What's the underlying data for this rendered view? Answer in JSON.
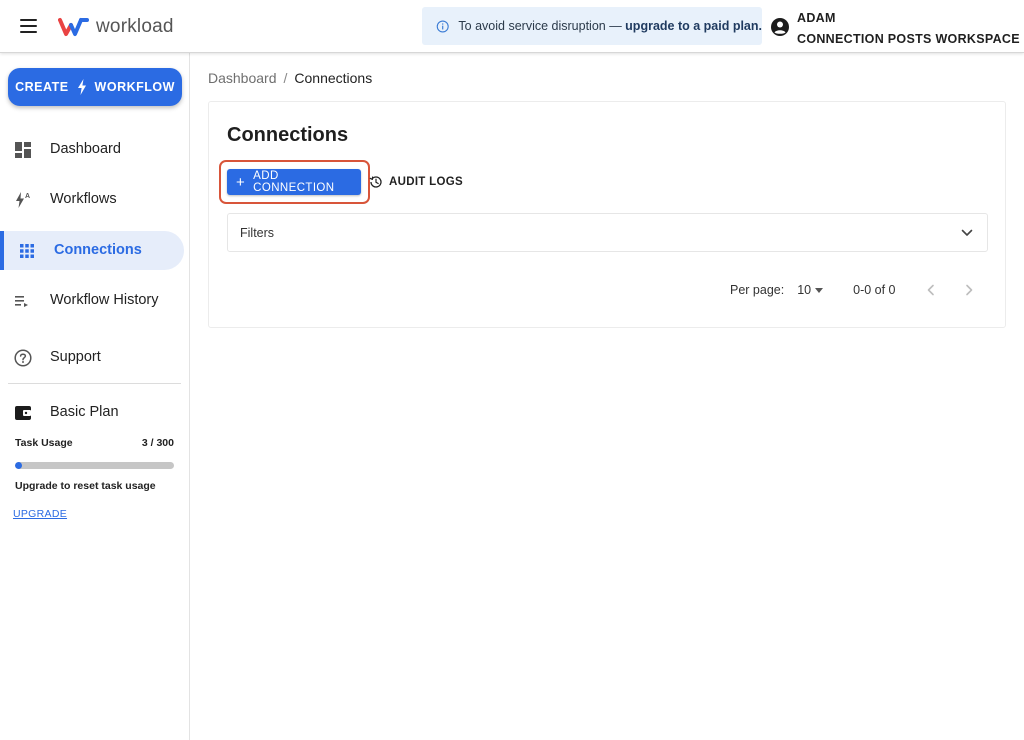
{
  "header": {
    "logo_text": "workload",
    "banner": {
      "text": "To avoid service disruption — ",
      "link": "upgrade to a paid plan."
    },
    "account": {
      "user": "ADAM",
      "workspace": "CONNECTION POSTS WORKSPACE"
    }
  },
  "sidebar": {
    "create_button": {
      "left": "CREATE",
      "right": "WORKFLOW"
    },
    "items": [
      {
        "label": "Dashboard",
        "icon": "dashboard-icon"
      },
      {
        "label": "Workflows",
        "icon": "workflows-icon"
      },
      {
        "label": "Connections",
        "icon": "apps-grid-icon",
        "active": true
      },
      {
        "label": "Workflow History",
        "icon": "history-list-icon"
      },
      {
        "label": "Support",
        "icon": "help-icon"
      }
    ],
    "plan": {
      "name": "Basic Plan",
      "usage_label": "Task Usage",
      "usage_value": "3 / 300",
      "usage_fraction": 0.01,
      "note": "Upgrade to reset task usage",
      "upgrade_link": "UPGRADE"
    }
  },
  "breadcrumb": {
    "root": "Dashboard",
    "separator": "/",
    "current": "Connections"
  },
  "main": {
    "title": "Connections",
    "add_button": "ADD CONNECTION",
    "audit_button": "AUDIT LOGS",
    "filters_label": "Filters",
    "pager": {
      "per_page_label": "Per page:",
      "per_page_value": "10",
      "range": "0-0 of 0"
    }
  },
  "colors": {
    "accent": "#2b6be3",
    "highlight": "#d8553a",
    "banner_bg": "#e8f1fb"
  }
}
